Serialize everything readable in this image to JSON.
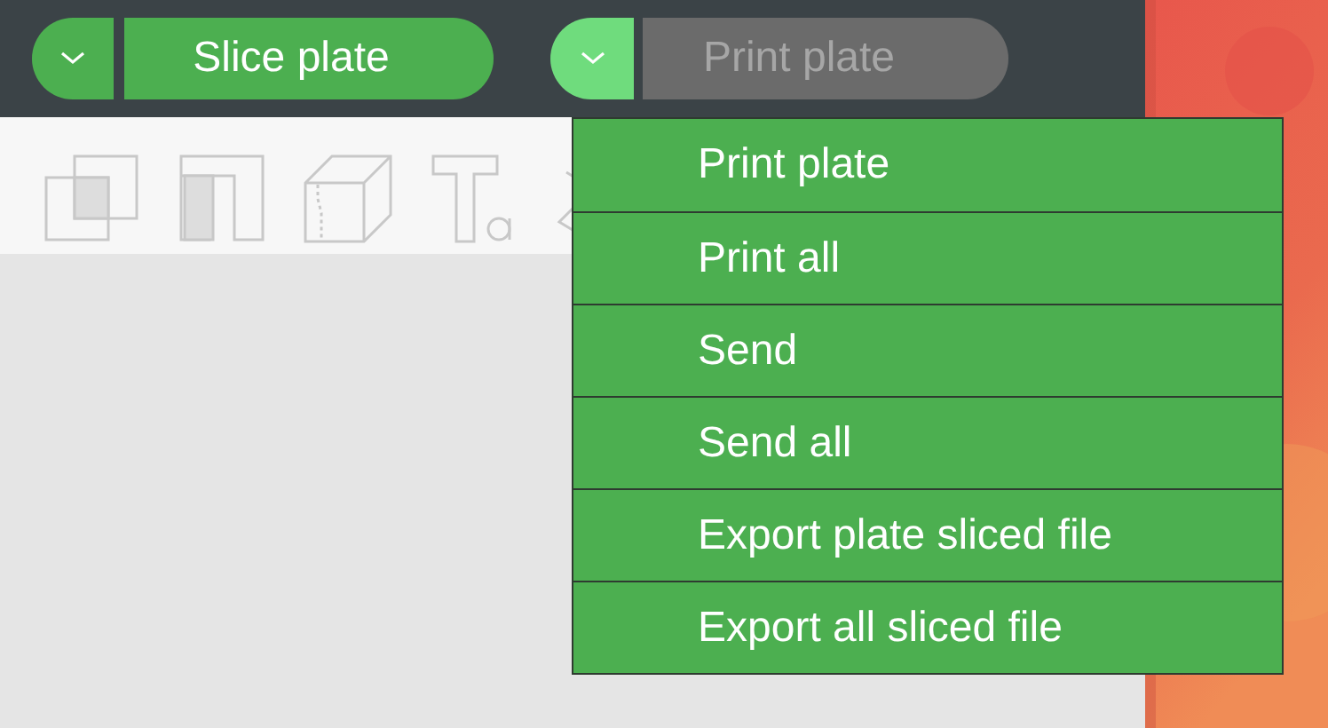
{
  "slice_button": {
    "label": "Slice plate"
  },
  "print_button": {
    "label": "Print plate",
    "disabled": true,
    "expanded": true
  },
  "print_menu": {
    "items": [
      {
        "label": "Print plate"
      },
      {
        "label": "Print all"
      },
      {
        "label": "Send"
      },
      {
        "label": "Send all"
      },
      {
        "label": "Export plate sliced file"
      },
      {
        "label": "Export all sliced file"
      }
    ]
  }
}
